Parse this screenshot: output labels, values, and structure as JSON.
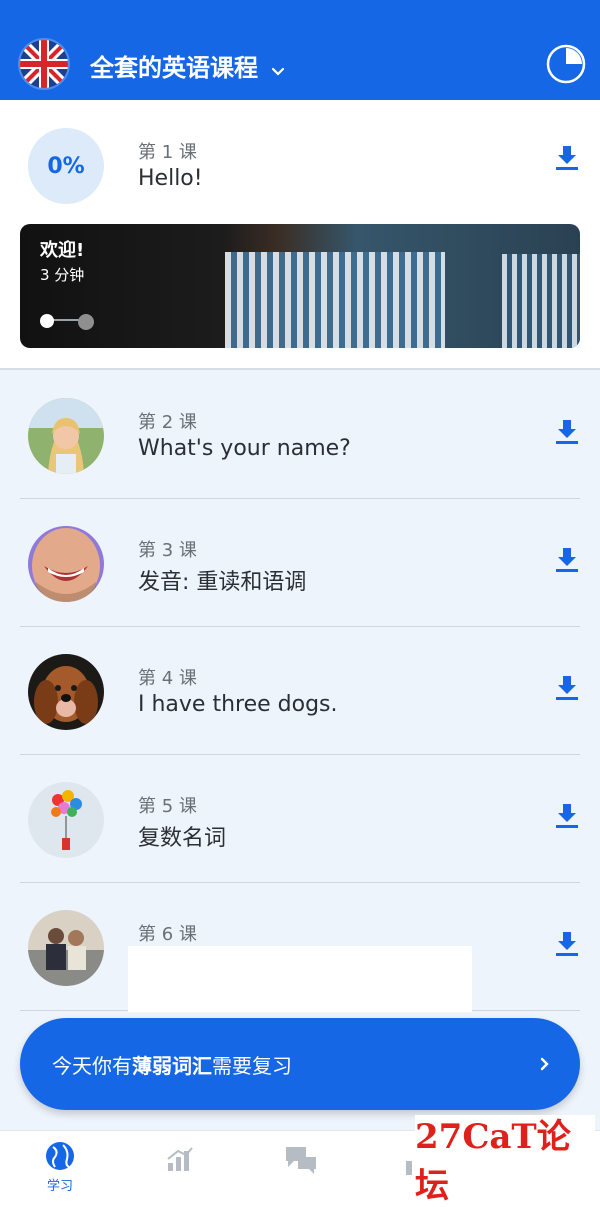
{
  "header": {
    "course_title": "全套的英语课程",
    "flag_icon": "uk-flag-icon",
    "progress_icon": "pie-progress-icon"
  },
  "lesson1": {
    "progress": "0%",
    "number": "第 1 课",
    "title": "Hello!",
    "banner": {
      "title": "欢迎!",
      "duration": "3 分钟"
    }
  },
  "lessons": [
    {
      "number": "第 2 课",
      "title": "What's your name?"
    },
    {
      "number": "第 3 课",
      "title": "发音: 重读和语调"
    },
    {
      "number": "第 4 课",
      "title": "I have three dogs."
    },
    {
      "number": "第 5 课",
      "title": "复数名词"
    },
    {
      "number": "第 6 课",
      "title": ""
    }
  ],
  "review": {
    "prefix": "今天你有",
    "bold": "薄弱词汇",
    "suffix": "需要复习"
  },
  "bottom_nav": {
    "learn_label": "学习"
  },
  "watermark": "27CaT论坛",
  "colors": {
    "primary": "#1667e6",
    "list_bg": "#eef4fc",
    "progress_bg": "#dceaf9"
  }
}
